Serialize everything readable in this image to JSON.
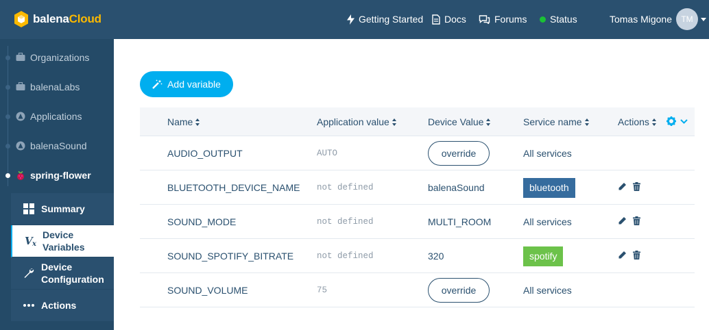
{
  "header": {
    "brand_part1": "balena",
    "brand_part2": "Cloud",
    "nav": [
      {
        "label": "Getting Started",
        "icon": "bolt-icon"
      },
      {
        "label": "Docs",
        "icon": "document-icon"
      },
      {
        "label": "Forums",
        "icon": "chat-icon"
      },
      {
        "label": "Status",
        "icon": "status-dot"
      }
    ],
    "user_name": "Tomas Migone",
    "avatar_initials": "TM"
  },
  "sidebar": {
    "breadcrumbs": [
      {
        "label": "Organizations",
        "icon": "briefcase-icon"
      },
      {
        "label": "balenaLabs",
        "icon": "briefcase-icon"
      },
      {
        "label": "Applications",
        "icon": "balena-app-icon"
      },
      {
        "label": "balenaSound",
        "icon": "balena-app-icon"
      },
      {
        "label": "spring-flower",
        "icon": "raspberry-pi-icon"
      }
    ],
    "subnav": [
      {
        "label": "Summary",
        "icon": "grid-icon"
      },
      {
        "label": "Device Variables",
        "icon": "variables-icon"
      },
      {
        "label": "Device Configuration",
        "icon": "wrench-icon"
      },
      {
        "label": "Actions",
        "icon": "more-icon"
      }
    ]
  },
  "main": {
    "add_button_label": "Add variable",
    "columns": [
      "Name",
      "Application value",
      "Device Value",
      "Service name",
      "Actions"
    ],
    "rows": [
      {
        "name": "AUDIO_OUTPUT",
        "app_value": "AUTO",
        "device_value": "override",
        "device_is_button": true,
        "service": "All services",
        "service_tag": false,
        "actions": false
      },
      {
        "name": "BLUETOOTH_DEVICE_NAME",
        "app_value": "not defined",
        "device_value": "balenaSound",
        "device_is_button": false,
        "service": "bluetooth",
        "service_tag": true,
        "tag_color": "#366c9e",
        "actions": true
      },
      {
        "name": "SOUND_MODE",
        "app_value": "not defined",
        "device_value": "MULTI_ROOM",
        "device_is_button": false,
        "service": "All services",
        "service_tag": false,
        "actions": true
      },
      {
        "name": "SOUND_SPOTIFY_BITRATE",
        "app_value": "not defined",
        "device_value": "320",
        "device_is_button": false,
        "service": "spotify",
        "service_tag": true,
        "tag_color": "#6cc24a",
        "actions": true
      },
      {
        "name": "SOUND_VOLUME",
        "app_value": "75",
        "device_value": "override",
        "device_is_button": true,
        "service": "All services",
        "service_tag": false,
        "actions": false
      }
    ]
  },
  "colors": {
    "header_bg": "#2a506f",
    "accent": "#00aeef",
    "brand_yellow": "#fcb900",
    "status_green": "#1ac135"
  }
}
